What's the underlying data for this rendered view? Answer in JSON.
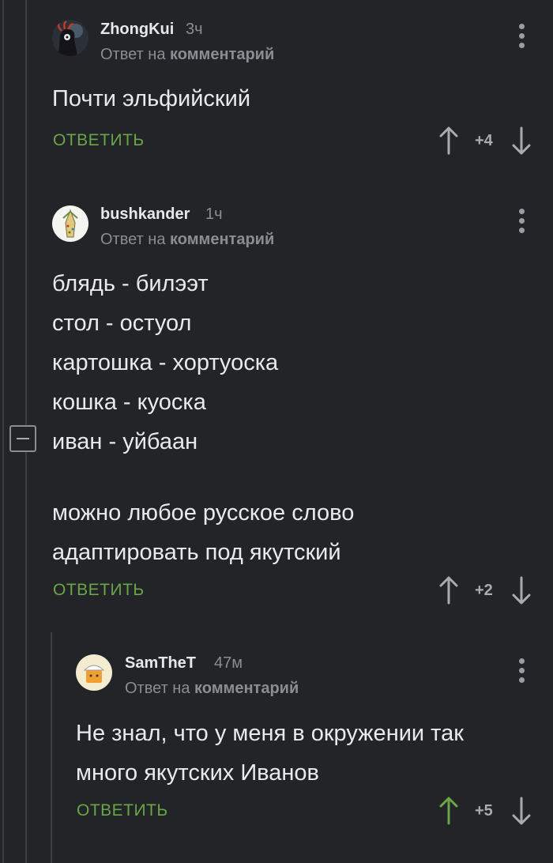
{
  "comments": [
    {
      "username": "ZhongKui",
      "time": "3ч",
      "reply_prefix": "Ответ на",
      "reply_link": "комментарий",
      "lines": [
        "Почти эльфийский"
      ],
      "reply_label": "ОТВЕТИТЬ",
      "score": "+4"
    },
    {
      "username": "bushkander",
      "time": "1ч",
      "reply_prefix": "Ответ на",
      "reply_link": "комментарий",
      "lines": [
        "блядь - билээт",
        "стол - остуол",
        "картошка - хортуоска",
        "кошка - куоска",
        "иван - уйбаан",
        "",
        "можно любое русское слово",
        "адаптировать под якутский"
      ],
      "reply_label": "ОТВЕТИТЬ",
      "score": "+2"
    },
    {
      "username": "SamTheT",
      "time": "47м",
      "reply_prefix": "Ответ на",
      "reply_link": "комментарий",
      "lines": [
        "Не знал, что у меня в окружении так",
        "много якутских Иванов"
      ],
      "reply_label": "ОТВЕТИТЬ",
      "score": "+5"
    }
  ],
  "colors": {
    "background": "#222427",
    "accent_green": "#6aa548",
    "muted": "#8a8d91",
    "upvote_active": "#6aa548"
  },
  "icons": {
    "upvote": "arrow-up-icon",
    "downvote": "arrow-down-icon",
    "menu": "kebab-menu-icon",
    "collapse": "minus-icon"
  }
}
